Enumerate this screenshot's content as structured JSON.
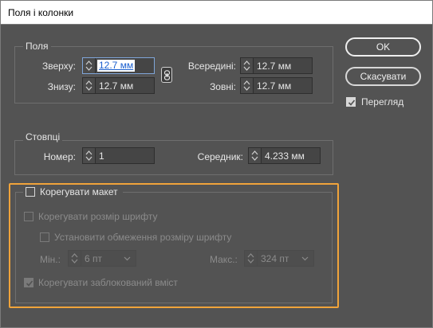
{
  "window": {
    "title": "Поля і колонки"
  },
  "margins": {
    "legend": "Поля",
    "top_label": "Зверху:",
    "top_value": "12.7 мм",
    "bottom_label": "Знизу:",
    "bottom_value": "12.7 мм",
    "inside_label": "Всередині:",
    "inside_value": "12.7 мм",
    "outside_label": "Зовні:",
    "outside_value": "12.7 мм"
  },
  "columns": {
    "legend": "Стовпці",
    "number_label": "Номер:",
    "number_value": "1",
    "gutter_label": "Середник:",
    "gutter_value": "4.233 мм"
  },
  "adjust": {
    "layout_label": "Корегувати макет",
    "layout_checked": false,
    "font_size_label": "Корегувати розмір шрифту",
    "font_size_checked": false,
    "limit_label": "Установити обмеження розміру шрифту",
    "limit_checked": false,
    "min_label": "Мін.:",
    "min_value": "6 пт",
    "max_label": "Макс.:",
    "max_value": "324 пт",
    "locked_label": "Корегувати заблокований вміст",
    "locked_checked": true
  },
  "buttons": {
    "ok": "OK",
    "cancel": "Скасувати"
  },
  "preview": {
    "label": "Перегляд",
    "checked": true
  },
  "colors": {
    "background": "#535353",
    "focus_outline": "#f0a33a",
    "selection": "#1a5fcf"
  }
}
